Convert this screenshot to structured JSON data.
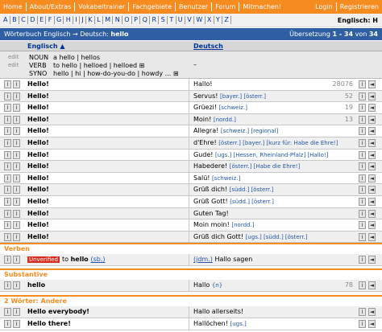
{
  "nav": {
    "items": [
      "Home",
      "About/Extras",
      "Vokabeltrainer",
      "Fachgebiete",
      "Benutzer",
      "Forum",
      "Mitmachen!"
    ],
    "login": "Login",
    "register": "Registrieren"
  },
  "alphabet": {
    "letters": [
      "A",
      "B",
      "C",
      "D",
      "E",
      "F",
      "G",
      "H",
      "I",
      "J",
      "K",
      "L",
      "M",
      "N",
      "O",
      "P",
      "Q",
      "R",
      "S",
      "T",
      "U",
      "V",
      "W",
      "X",
      "Y",
      "Z"
    ],
    "language": "Englisch: H"
  },
  "titlebar": {
    "prefix": "Wörterbuch Englisch → Deutsch: ",
    "term": "hello",
    "count_prefix": "Übersetzung ",
    "count": "1 - 34",
    "count_mid": " von ",
    "total": "34"
  },
  "columns": {
    "english": "Englisch ▲",
    "german": "Deutsch"
  },
  "grammar": {
    "edit_label": "edit",
    "noun": {
      "pos": "NOUN",
      "text": "a hello | hellos"
    },
    "verb": {
      "pos": "VERB",
      "text": "to hello | helloed | helloed ⊞"
    },
    "syno": {
      "pos": "SYNO",
      "text": "hello | hi | how-do-you-do | howdy ... ⊞"
    },
    "german": "–"
  },
  "buttons": {
    "info": "i",
    "left": "◄"
  },
  "rows": [
    {
      "en": "Hello!",
      "de": "Hallo!",
      "tags": "",
      "num": "28076"
    },
    {
      "en": "Hello!",
      "de": "Servus!",
      "tags": "[bayer.] [österr.]",
      "num": "52"
    },
    {
      "en": "Hello!",
      "de": "Grüezi!",
      "tags": "[schweiz.]",
      "num": "19"
    },
    {
      "en": "Hello!",
      "de": "Moin!",
      "tags": "[nordd.]",
      "num": "13"
    },
    {
      "en": "Hello!",
      "de": "Allegra!",
      "tags": "[schweiz.] [regional]",
      "num": ""
    },
    {
      "en": "Hello!",
      "de": "d'Ehre!",
      "tags": "[österr.] [bayer.] [kurz für: Habe die Ehre!]",
      "num": ""
    },
    {
      "en": "Hello!",
      "de": "Gude!",
      "tags": "[ugs.] [Hessen, Rheinland-Pfalz] [Hallo!]",
      "num": ""
    },
    {
      "en": "Hello!",
      "de": "Habedere!",
      "tags": "[österr.] [Habe die Ehre!]",
      "num": ""
    },
    {
      "en": "Hello!",
      "de": "Salü!",
      "tags": "[schweiz.]",
      "num": ""
    },
    {
      "en": "Hello!",
      "de": "Grüß dich!",
      "tags": "[südd.] [österr.]",
      "num": ""
    },
    {
      "en": "Hello!",
      "de": "Grüß Gott!",
      "tags": "[südd.] [österr.]",
      "num": ""
    },
    {
      "en": "Hello!",
      "de": "Guten Tag!",
      "tags": "",
      "num": ""
    },
    {
      "en": "Hello!",
      "de": "Moin moin!",
      "tags": "[nordd.]",
      "num": ""
    },
    {
      "en": "Hello!",
      "de": "Grüß dich Gott!",
      "tags": "[ugs.] [südd.] [österr.]",
      "num": ""
    }
  ],
  "verben": {
    "label": "Verben",
    "unverified": "Unverified",
    "en_prefix": "to ",
    "en_word": "hello",
    "en_tag": "(sb.)",
    "de_tag": "(jdm.)",
    "de_text": "Hallo sagen"
  },
  "substantive": {
    "label": "Substantive",
    "en": "hello",
    "de": "Hallo",
    "de_tag": "{n}",
    "num": "78"
  },
  "zwei_woerter": {
    "label": "2 Wörter: Andere",
    "rows": [
      {
        "en": "Hello everybody!",
        "de": "Hallo allerseits!",
        "tags": ""
      },
      {
        "en": "Hello there!",
        "de": "Hallöchen!",
        "tags": "[ugs.]"
      }
    ]
  }
}
